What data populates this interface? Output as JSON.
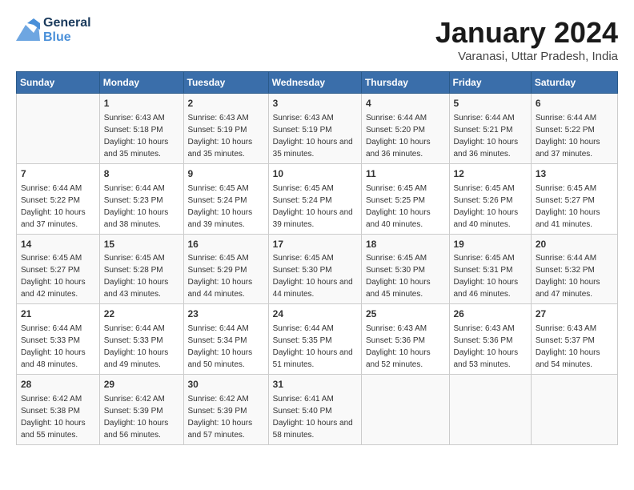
{
  "header": {
    "logo": {
      "line1": "General",
      "line2": "Blue"
    },
    "title": "January 2024",
    "subtitle": "Varanasi, Uttar Pradesh, India"
  },
  "days_of_week": [
    "Sunday",
    "Monday",
    "Tuesday",
    "Wednesday",
    "Thursday",
    "Friday",
    "Saturday"
  ],
  "weeks": [
    [
      {
        "day": "",
        "sunrise": "",
        "sunset": "",
        "daylight": ""
      },
      {
        "day": "1",
        "sunrise": "Sunrise: 6:43 AM",
        "sunset": "Sunset: 5:18 PM",
        "daylight": "Daylight: 10 hours and 35 minutes."
      },
      {
        "day": "2",
        "sunrise": "Sunrise: 6:43 AM",
        "sunset": "Sunset: 5:19 PM",
        "daylight": "Daylight: 10 hours and 35 minutes."
      },
      {
        "day": "3",
        "sunrise": "Sunrise: 6:43 AM",
        "sunset": "Sunset: 5:19 PM",
        "daylight": "Daylight: 10 hours and 35 minutes."
      },
      {
        "day": "4",
        "sunrise": "Sunrise: 6:44 AM",
        "sunset": "Sunset: 5:20 PM",
        "daylight": "Daylight: 10 hours and 36 minutes."
      },
      {
        "day": "5",
        "sunrise": "Sunrise: 6:44 AM",
        "sunset": "Sunset: 5:21 PM",
        "daylight": "Daylight: 10 hours and 36 minutes."
      },
      {
        "day": "6",
        "sunrise": "Sunrise: 6:44 AM",
        "sunset": "Sunset: 5:22 PM",
        "daylight": "Daylight: 10 hours and 37 minutes."
      }
    ],
    [
      {
        "day": "7",
        "sunrise": "Sunrise: 6:44 AM",
        "sunset": "Sunset: 5:22 PM",
        "daylight": "Daylight: 10 hours and 37 minutes."
      },
      {
        "day": "8",
        "sunrise": "Sunrise: 6:44 AM",
        "sunset": "Sunset: 5:23 PM",
        "daylight": "Daylight: 10 hours and 38 minutes."
      },
      {
        "day": "9",
        "sunrise": "Sunrise: 6:45 AM",
        "sunset": "Sunset: 5:24 PM",
        "daylight": "Daylight: 10 hours and 39 minutes."
      },
      {
        "day": "10",
        "sunrise": "Sunrise: 6:45 AM",
        "sunset": "Sunset: 5:24 PM",
        "daylight": "Daylight: 10 hours and 39 minutes."
      },
      {
        "day": "11",
        "sunrise": "Sunrise: 6:45 AM",
        "sunset": "Sunset: 5:25 PM",
        "daylight": "Daylight: 10 hours and 40 minutes."
      },
      {
        "day": "12",
        "sunrise": "Sunrise: 6:45 AM",
        "sunset": "Sunset: 5:26 PM",
        "daylight": "Daylight: 10 hours and 40 minutes."
      },
      {
        "day": "13",
        "sunrise": "Sunrise: 6:45 AM",
        "sunset": "Sunset: 5:27 PM",
        "daylight": "Daylight: 10 hours and 41 minutes."
      }
    ],
    [
      {
        "day": "14",
        "sunrise": "Sunrise: 6:45 AM",
        "sunset": "Sunset: 5:27 PM",
        "daylight": "Daylight: 10 hours and 42 minutes."
      },
      {
        "day": "15",
        "sunrise": "Sunrise: 6:45 AM",
        "sunset": "Sunset: 5:28 PM",
        "daylight": "Daylight: 10 hours and 43 minutes."
      },
      {
        "day": "16",
        "sunrise": "Sunrise: 6:45 AM",
        "sunset": "Sunset: 5:29 PM",
        "daylight": "Daylight: 10 hours and 44 minutes."
      },
      {
        "day": "17",
        "sunrise": "Sunrise: 6:45 AM",
        "sunset": "Sunset: 5:30 PM",
        "daylight": "Daylight: 10 hours and 44 minutes."
      },
      {
        "day": "18",
        "sunrise": "Sunrise: 6:45 AM",
        "sunset": "Sunset: 5:30 PM",
        "daylight": "Daylight: 10 hours and 45 minutes."
      },
      {
        "day": "19",
        "sunrise": "Sunrise: 6:45 AM",
        "sunset": "Sunset: 5:31 PM",
        "daylight": "Daylight: 10 hours and 46 minutes."
      },
      {
        "day": "20",
        "sunrise": "Sunrise: 6:44 AM",
        "sunset": "Sunset: 5:32 PM",
        "daylight": "Daylight: 10 hours and 47 minutes."
      }
    ],
    [
      {
        "day": "21",
        "sunrise": "Sunrise: 6:44 AM",
        "sunset": "Sunset: 5:33 PM",
        "daylight": "Daylight: 10 hours and 48 minutes."
      },
      {
        "day": "22",
        "sunrise": "Sunrise: 6:44 AM",
        "sunset": "Sunset: 5:33 PM",
        "daylight": "Daylight: 10 hours and 49 minutes."
      },
      {
        "day": "23",
        "sunrise": "Sunrise: 6:44 AM",
        "sunset": "Sunset: 5:34 PM",
        "daylight": "Daylight: 10 hours and 50 minutes."
      },
      {
        "day": "24",
        "sunrise": "Sunrise: 6:44 AM",
        "sunset": "Sunset: 5:35 PM",
        "daylight": "Daylight: 10 hours and 51 minutes."
      },
      {
        "day": "25",
        "sunrise": "Sunrise: 6:43 AM",
        "sunset": "Sunset: 5:36 PM",
        "daylight": "Daylight: 10 hours and 52 minutes."
      },
      {
        "day": "26",
        "sunrise": "Sunrise: 6:43 AM",
        "sunset": "Sunset: 5:36 PM",
        "daylight": "Daylight: 10 hours and 53 minutes."
      },
      {
        "day": "27",
        "sunrise": "Sunrise: 6:43 AM",
        "sunset": "Sunset: 5:37 PM",
        "daylight": "Daylight: 10 hours and 54 minutes."
      }
    ],
    [
      {
        "day": "28",
        "sunrise": "Sunrise: 6:42 AM",
        "sunset": "Sunset: 5:38 PM",
        "daylight": "Daylight: 10 hours and 55 minutes."
      },
      {
        "day": "29",
        "sunrise": "Sunrise: 6:42 AM",
        "sunset": "Sunset: 5:39 PM",
        "daylight": "Daylight: 10 hours and 56 minutes."
      },
      {
        "day": "30",
        "sunrise": "Sunrise: 6:42 AM",
        "sunset": "Sunset: 5:39 PM",
        "daylight": "Daylight: 10 hours and 57 minutes."
      },
      {
        "day": "31",
        "sunrise": "Sunrise: 6:41 AM",
        "sunset": "Sunset: 5:40 PM",
        "daylight": "Daylight: 10 hours and 58 minutes."
      },
      {
        "day": "",
        "sunrise": "",
        "sunset": "",
        "daylight": ""
      },
      {
        "day": "",
        "sunrise": "",
        "sunset": "",
        "daylight": ""
      },
      {
        "day": "",
        "sunrise": "",
        "sunset": "",
        "daylight": ""
      }
    ]
  ]
}
